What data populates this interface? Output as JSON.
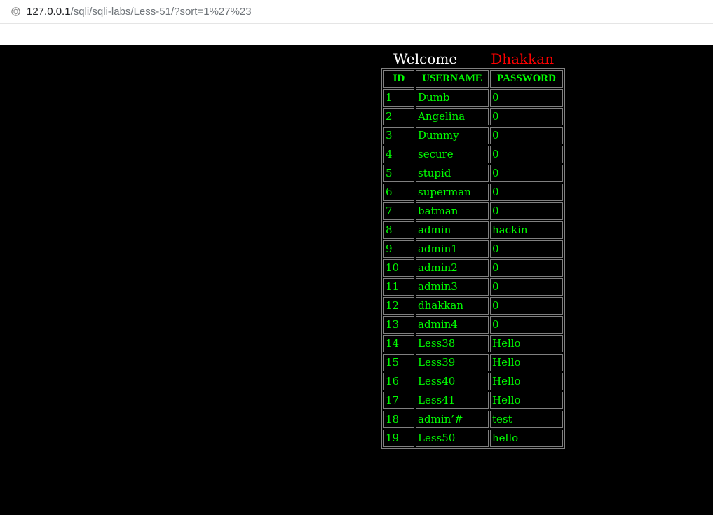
{
  "browser": {
    "url_host": "127.0.0.1",
    "url_path": "/sqli/sqli-labs/Less-51/?sort=1%27%23",
    "site_icon": "shield-icon"
  },
  "welcome": {
    "label": "Welcome",
    "user": "Dhakkan",
    "user_color": "#ff0000"
  },
  "table": {
    "headers": [
      "ID",
      "USERNAME",
      "PASSWORD"
    ],
    "rows": [
      [
        "1",
        "Dumb",
        "0"
      ],
      [
        "2",
        "Angelina",
        "0"
      ],
      [
        "3",
        "Dummy",
        "0"
      ],
      [
        "4",
        "secure",
        "0"
      ],
      [
        "5",
        "stupid",
        "0"
      ],
      [
        "6",
        "superman",
        "0"
      ],
      [
        "7",
        "batman",
        "0"
      ],
      [
        "8",
        "admin",
        "hackin"
      ],
      [
        "9",
        "admin1",
        "0"
      ],
      [
        "10",
        "admin2",
        "0"
      ],
      [
        "11",
        "admin3",
        "0"
      ],
      [
        "12",
        "dhakkan",
        "0"
      ],
      [
        "13",
        "admin4",
        "0"
      ],
      [
        "14",
        "Less38",
        "Hello"
      ],
      [
        "15",
        "Less39",
        "Hello"
      ],
      [
        "16",
        "Less40",
        "Hello"
      ],
      [
        "17",
        "Less41",
        "Hello"
      ],
      [
        "18",
        "admin’#",
        "test"
      ],
      [
        "19",
        "Less50",
        "hello"
      ]
    ],
    "text_color": "#00ff00"
  }
}
